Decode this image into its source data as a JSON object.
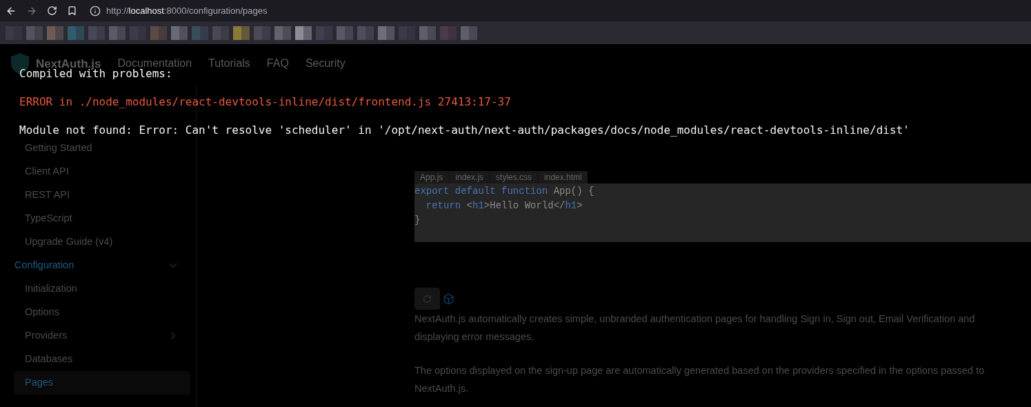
{
  "browser": {
    "url": {
      "scheme": "http://",
      "host": "localhost",
      "rest": ":8000/configuration/pages"
    }
  },
  "navbar": {
    "brand": "NextAuth.js",
    "links": [
      "Documentation",
      "Tutorials",
      "FAQ",
      "Security"
    ]
  },
  "sidebar": {
    "items": [
      {
        "kind": "item",
        "label": "Getting Started",
        "selected": false
      },
      {
        "kind": "item",
        "label": "Client API",
        "selected": false
      },
      {
        "kind": "item",
        "label": "REST API",
        "selected": false
      },
      {
        "kind": "item",
        "label": "TypeScript",
        "selected": false
      },
      {
        "kind": "item",
        "label": "Upgrade Guide (v4)",
        "selected": false
      },
      {
        "kind": "section",
        "label": "Configuration",
        "expanded": true,
        "children": [
          {
            "kind": "item",
            "label": "Initialization",
            "selected": false
          },
          {
            "kind": "item",
            "label": "Options",
            "selected": false
          },
          {
            "kind": "group",
            "label": "Providers",
            "expanded": false
          },
          {
            "kind": "item",
            "label": "Databases",
            "selected": false
          },
          {
            "kind": "item",
            "label": "Pages",
            "selected": true
          }
        ]
      }
    ]
  },
  "editor": {
    "tabs": [
      {
        "label": "App.js",
        "selected": false
      },
      {
        "label": "index.js",
        "selected": false
      },
      {
        "label": "styles.css",
        "selected": false
      },
      {
        "label": "index.html",
        "selected": false
      }
    ],
    "lines": [
      [
        {
          "kind": "keyword",
          "text": "export default function"
        },
        {
          "kind": "plain",
          "text": " App() {"
        }
      ],
      [
        {
          "kind": "keyword",
          "text": "  return"
        },
        {
          "kind": "plain",
          "text": " <"
        },
        {
          "kind": "keyword",
          "text": "h1"
        },
        {
          "kind": "plain",
          "text": ">Hello World</"
        },
        {
          "kind": "keyword",
          "text": "h1"
        },
        {
          "kind": "plain",
          "text": ">"
        }
      ],
      [
        {
          "kind": "plain",
          "text": "}"
        }
      ]
    ]
  },
  "paragraphs": [
    "NextAuth.js automatically creates simple, unbranded authentication pages for handling Sign in, Sign out, Email Verification and displaying error messages.",
    "The options displayed on the sign-up page are automatically generated based on the providers specified in the options passed to NextAuth.js."
  ],
  "overlay": {
    "title": "Compiled with problems:",
    "error": "ERROR in ./node_modules/react-devtools-inline/dist/frontend.js 27413:17-37",
    "message": "Module not found: Error: Can't resolve 'scheduler' in '/opt/next-auth/next-auth/packages/docs/node_modules/react-devtools-inline/dist'"
  }
}
